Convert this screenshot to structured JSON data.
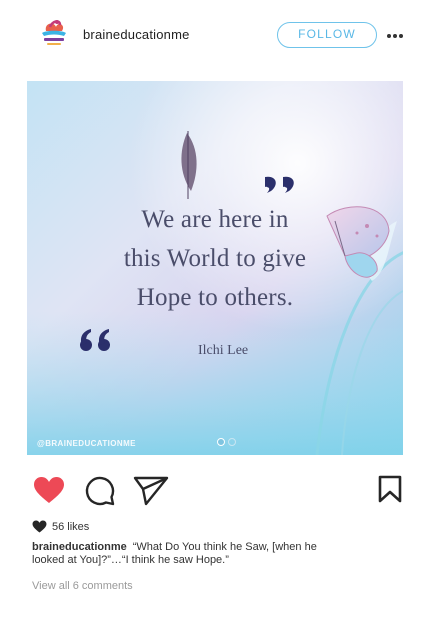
{
  "header": {
    "username": "braineducationme",
    "follow_label": "FOLLOW",
    "more_icon": "more-horizontal-icon",
    "accent_color": "#6fc3ea"
  },
  "post": {
    "quote_lines": [
      "We are here in",
      "this World to give",
      "Hope to others."
    ],
    "author": "Ilchi Lee",
    "watermark": "@BRAINEDUCATIONME",
    "carousel": {
      "total": 2,
      "current": 1
    }
  },
  "actions": {
    "like_icon": "heart-filled-icon",
    "comment_icon": "comment-icon",
    "share_icon": "send-icon",
    "bookmark_icon": "bookmark-icon",
    "like_color": "#ed4956"
  },
  "likes": {
    "text": "56 likes"
  },
  "caption": {
    "username": "braineducationme",
    "text": "“What Do You think he Saw, [when he looked at You]?”…“I think he saw Hope.”"
  },
  "comments": {
    "view_all": "View all 6 comments"
  }
}
